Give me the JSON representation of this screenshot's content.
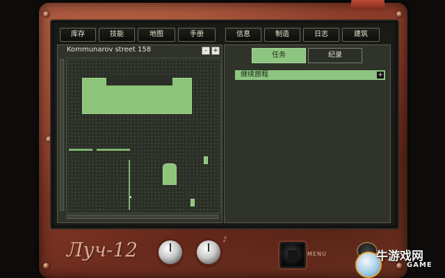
{
  "tabs": [
    {
      "label": "库存"
    },
    {
      "label": "技能"
    },
    {
      "label": "地图"
    },
    {
      "label": "手册"
    },
    {
      "label": "信息"
    },
    {
      "label": "制造"
    },
    {
      "label": "日志"
    },
    {
      "label": "建筑"
    }
  ],
  "map": {
    "location": "Kommunarov street 158",
    "minus_label": "-",
    "plus_label": "+"
  },
  "journal": {
    "tabs": [
      {
        "label": "任务",
        "active": true
      },
      {
        "label": "纪录",
        "active": false
      }
    ],
    "quests": [
      {
        "label": "继续旅程",
        "expand_label": "+"
      }
    ]
  },
  "device": {
    "logo": "Луч-12",
    "menu_label": "MENU"
  },
  "watermark": {
    "text": "牛游戏网",
    "sub": "GAME"
  },
  "colors": {
    "casing": "#8a3b28",
    "screen": "#2f332a",
    "accent_green": "#8ec581"
  }
}
